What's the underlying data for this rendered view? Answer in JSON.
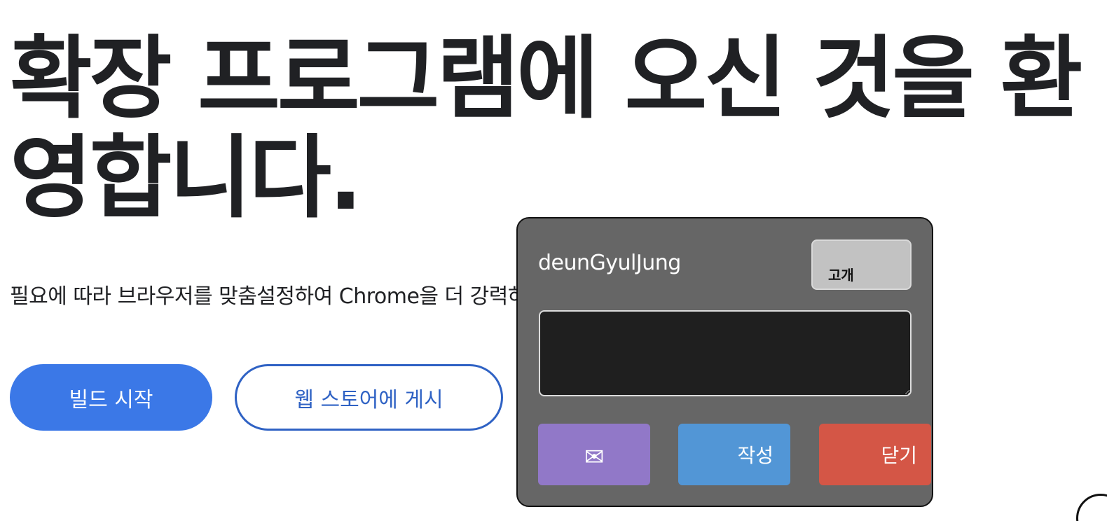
{
  "hero": {
    "title": "확장 프로그램에 오신 것을 환영합니다.",
    "subtitle": "필요에 따라 브라우저를 맞춤설정하여 Chrome을 더 강력하게 만들어 보세요."
  },
  "actions": {
    "start_build": "빌드 시작",
    "publish_webstore": "웹 스토어에 게시"
  },
  "panel": {
    "username": "deunGyulJung",
    "visibility_label": "고개",
    "note_value": "",
    "mail_icon": "✉",
    "write_label": "작성",
    "close_label": "닫기"
  },
  "colors": {
    "primary": "#3b78e7",
    "outline": "#2f62c4",
    "panel_bg": "#666666",
    "mail_button": "#9178c8",
    "write_button": "#5296d6",
    "close_button": "#d45646"
  }
}
